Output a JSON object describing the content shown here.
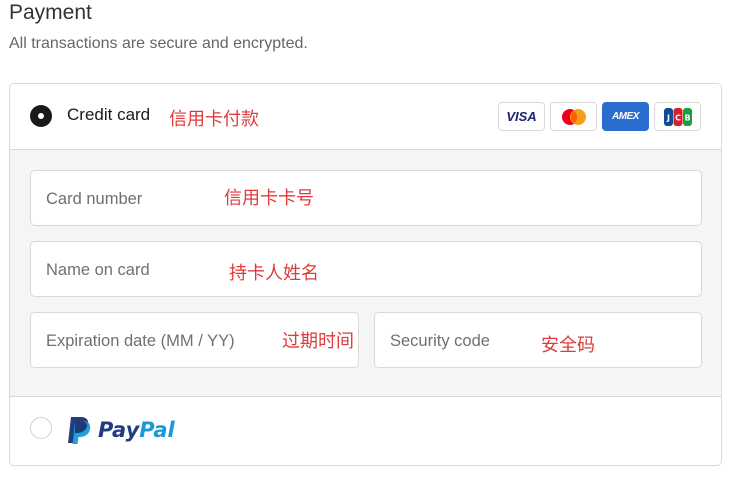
{
  "header": {
    "title": "Payment",
    "subtitle": "All transactions are secure and encrypted."
  },
  "credit_card": {
    "label": "Credit card",
    "selected": true,
    "annotation": "信用卡付款",
    "logos": {
      "visa": "VISA",
      "mastercard": "mastercard-icon",
      "amex": "AMEX",
      "jcb": "JCB"
    }
  },
  "fields": {
    "card_number": {
      "placeholder": "Card number",
      "annotation": "信用卡卡号"
    },
    "name_on_card": {
      "placeholder": "Name on card",
      "annotation": "持卡人姓名"
    },
    "expiration": {
      "placeholder": "Expiration date (MM / YY)",
      "annotation": "过期时间"
    },
    "security_code": {
      "placeholder": "Security code",
      "annotation": "安全码"
    }
  },
  "paypal": {
    "pay": "Pay",
    "pal": "Pal",
    "selected": false
  },
  "colors": {
    "annotation": "#e03a3a",
    "border": "#d9d9d9",
    "form_bg": "#f5f5f5",
    "paypal_dark": "#253b80",
    "paypal_light": "#179bd7",
    "amex_blue": "#2a6dcf",
    "visa_navy": "#1a1f71"
  }
}
